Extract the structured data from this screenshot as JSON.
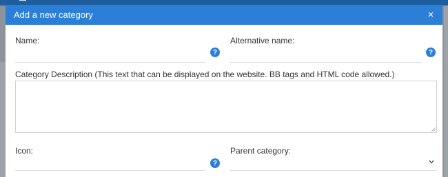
{
  "dialog": {
    "title": "Add a new category",
    "close_label": "×"
  },
  "fields": {
    "name": {
      "label": "Name:",
      "value": "",
      "help": "?"
    },
    "alt_name": {
      "label": "Alternative name:",
      "value": "",
      "help": "?"
    },
    "description": {
      "label": "Category Description (This text that can be displayed on the website. BB tags and HTML code allowed.)",
      "value": ""
    },
    "icon": {
      "label": "Icon:",
      "value": "",
      "help": "?"
    },
    "parent": {
      "label": "Parent category:",
      "selected": ""
    }
  },
  "colors": {
    "header": "#2b7fd8",
    "help_icon": "#2b7fd8",
    "backdrop": "#8e9399"
  }
}
